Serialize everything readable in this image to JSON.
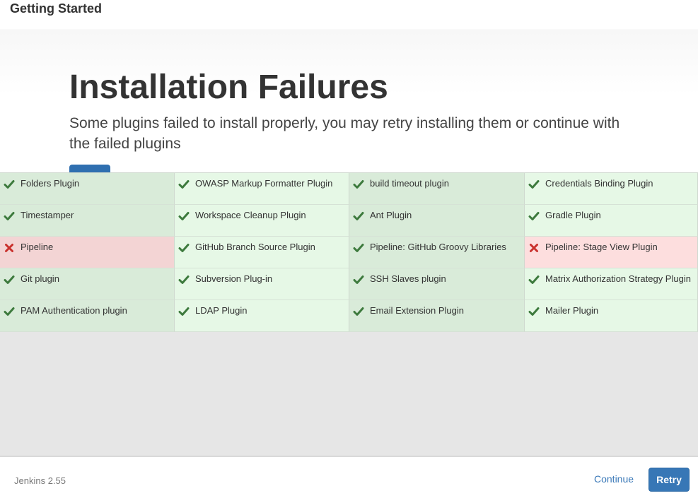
{
  "header": {
    "title": "Getting Started"
  },
  "hero": {
    "title": "Installation Failures",
    "text": "Some plugins failed to install properly, you may retry installing them or continue with the failed plugins"
  },
  "plugins": [
    {
      "name": "Folders Plugin",
      "status": "success"
    },
    {
      "name": "OWASP Markup Formatter Plugin",
      "status": "success"
    },
    {
      "name": "build timeout plugin",
      "status": "success"
    },
    {
      "name": "Credentials Binding Plugin",
      "status": "success"
    },
    {
      "name": "Timestamper",
      "status": "success"
    },
    {
      "name": "Workspace Cleanup Plugin",
      "status": "success"
    },
    {
      "name": "Ant Plugin",
      "status": "success"
    },
    {
      "name": "Gradle Plugin",
      "status": "success"
    },
    {
      "name": "Pipeline",
      "status": "failed"
    },
    {
      "name": "GitHub Branch Source Plugin",
      "status": "success"
    },
    {
      "name": "Pipeline: GitHub Groovy Libraries",
      "status": "success"
    },
    {
      "name": "Pipeline: Stage View Plugin",
      "status": "failed"
    },
    {
      "name": "Git plugin",
      "status": "success"
    },
    {
      "name": "Subversion Plug-in",
      "status": "success"
    },
    {
      "name": "SSH Slaves plugin",
      "status": "success"
    },
    {
      "name": "Matrix Authorization Strategy Plugin",
      "status": "success"
    },
    {
      "name": "PAM Authentication plugin",
      "status": "success"
    },
    {
      "name": "LDAP Plugin",
      "status": "success"
    },
    {
      "name": "Email Extension Plugin",
      "status": "success"
    },
    {
      "name": "Mailer Plugin",
      "status": "success"
    }
  ],
  "icons": {
    "success": "check-icon",
    "failed": "cross-icon"
  },
  "colors": {
    "success_icon": "#3d7a3d",
    "failed_icon": "#c9302c",
    "success_bg_dark": "#d9ebd9",
    "success_bg_light": "#e6f8e6",
    "failed_bg": "#f3d4d4",
    "accent": "#3777b6"
  },
  "footer": {
    "version": "Jenkins 2.55",
    "continue_label": "Continue",
    "retry_label": "Retry"
  }
}
